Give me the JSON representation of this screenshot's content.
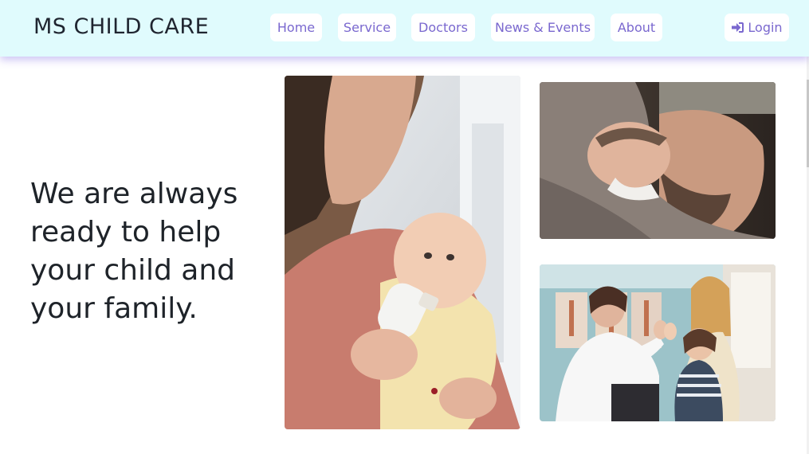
{
  "navbar": {
    "brand": "MS CHILD CARE",
    "links": [
      "Home",
      "Service",
      "Doctors",
      "News & Events",
      "About"
    ],
    "login_label": "Login",
    "login_icon": "sign-in-icon",
    "background_color": "#e0fbfd",
    "accent_color": "#7a68cf"
  },
  "hero": {
    "headline_lines": [
      "We are always",
      "ready to help",
      "your child and",
      "your family."
    ]
  },
  "gallery": {
    "images": [
      "mother-feeding-baby-photo",
      "father-with-newborn-photo",
      "doctor-high-five-child-photo"
    ]
  }
}
